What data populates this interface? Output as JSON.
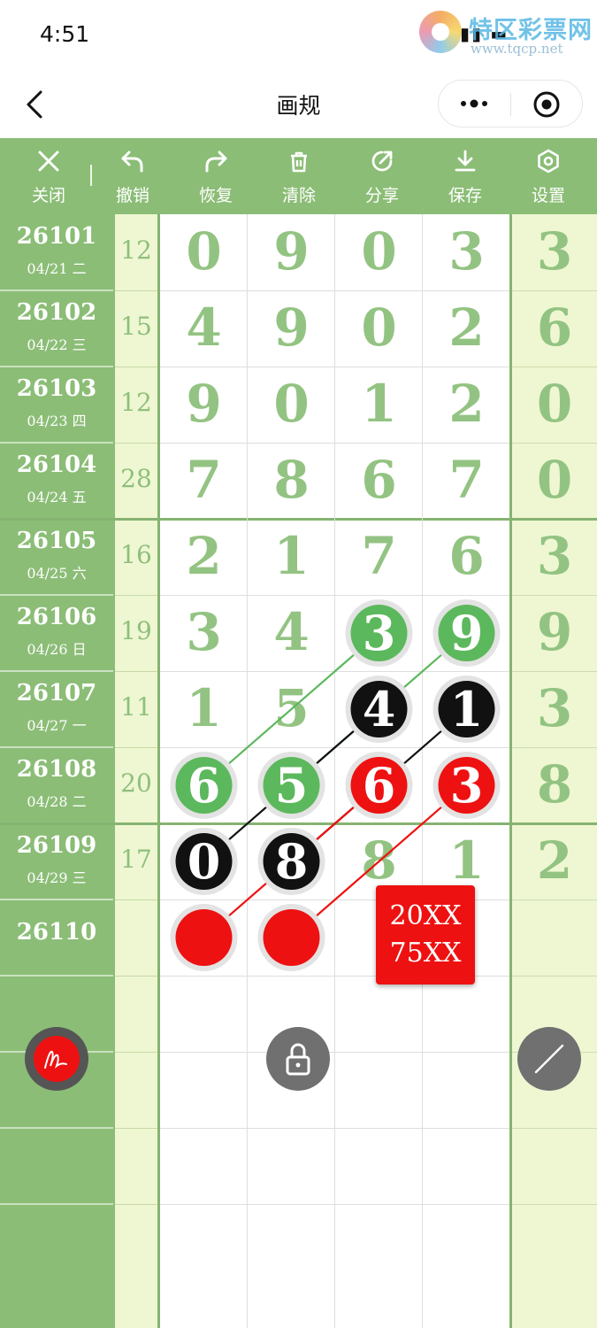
{
  "status_bar": {
    "time": "4:51",
    "watermark": "特区彩票网",
    "watermark_url": "www.tqcp.net"
  },
  "nav": {
    "title": "画规"
  },
  "toolbar": [
    {
      "key": "close",
      "label": "关闭",
      "icon": "close-icon"
    },
    {
      "key": "undo",
      "label": "撤销",
      "icon": "undo-icon"
    },
    {
      "key": "redo",
      "label": "恢复",
      "icon": "redo-icon"
    },
    {
      "key": "clear",
      "label": "清除",
      "icon": "trash-icon"
    },
    {
      "key": "share",
      "label": "分享",
      "icon": "share-icon"
    },
    {
      "key": "save",
      "label": "保存",
      "icon": "download-icon"
    },
    {
      "key": "settings",
      "label": "设置",
      "icon": "hexagon-gear-icon"
    }
  ],
  "rows": [
    {
      "issue": "26101",
      "date": "04/21 二",
      "sum": "12",
      "digits": [
        "0",
        "9",
        "0",
        "3"
      ],
      "tail": "3"
    },
    {
      "issue": "26102",
      "date": "04/22 三",
      "sum": "15",
      "digits": [
        "4",
        "9",
        "0",
        "2"
      ],
      "tail": "6"
    },
    {
      "issue": "26103",
      "date": "04/23 四",
      "sum": "12",
      "digits": [
        "9",
        "0",
        "1",
        "2"
      ],
      "tail": "0"
    },
    {
      "issue": "26104",
      "date": "04/24 五",
      "sum": "28",
      "digits": [
        "7",
        "8",
        "6",
        "7"
      ],
      "tail": "0"
    },
    {
      "issue": "26105",
      "date": "04/25 六",
      "sum": "16",
      "digits": [
        "2",
        "1",
        "7",
        "6"
      ],
      "tail": "3"
    },
    {
      "issue": "26106",
      "date": "04/26 日",
      "sum": "19",
      "digits": [
        "3",
        "4",
        "3",
        "9"
      ],
      "tail": "9"
    },
    {
      "issue": "26107",
      "date": "04/27 一",
      "sum": "11",
      "digits": [
        "1",
        "5",
        "4",
        "1"
      ],
      "tail": "3"
    },
    {
      "issue": "26108",
      "date": "04/28 二",
      "sum": "20",
      "digits": [
        "6",
        "5",
        "6",
        "3"
      ],
      "tail": "8"
    },
    {
      "issue": "26109",
      "date": "04/29 三",
      "sum": "17",
      "digits": [
        "0",
        "8",
        "8",
        "1"
      ],
      "tail": "2"
    },
    {
      "issue": "26110",
      "date": "",
      "sum": "",
      "digits": [
        "",
        "",
        "",
        ""
      ],
      "tail": ""
    }
  ],
  "markers": [
    {
      "row": 5,
      "col": 2,
      "color": "green",
      "value": "3"
    },
    {
      "row": 5,
      "col": 3,
      "color": "green",
      "value": "9"
    },
    {
      "row": 6,
      "col": 2,
      "color": "black",
      "value": "4"
    },
    {
      "row": 6,
      "col": 3,
      "color": "black",
      "value": "1"
    },
    {
      "row": 7,
      "col": 0,
      "color": "green",
      "value": "6"
    },
    {
      "row": 7,
      "col": 1,
      "color": "green",
      "value": "5"
    },
    {
      "row": 7,
      "col": 2,
      "color": "red",
      "value": "6"
    },
    {
      "row": 7,
      "col": 3,
      "color": "red",
      "value": "3"
    },
    {
      "row": 8,
      "col": 0,
      "color": "black",
      "value": "0"
    },
    {
      "row": 8,
      "col": 1,
      "color": "black",
      "value": "8"
    },
    {
      "row": 9,
      "col": 0,
      "color": "red",
      "value": ""
    },
    {
      "row": 9,
      "col": 1,
      "color": "red",
      "value": ""
    }
  ],
  "lines": [
    {
      "color": "green",
      "from": [
        7,
        0
      ],
      "to": [
        5,
        2
      ]
    },
    {
      "color": "green",
      "from": [
        7,
        1
      ],
      "to": [
        5,
        3
      ]
    },
    {
      "color": "black",
      "from": [
        8,
        0
      ],
      "to": [
        6,
        2
      ]
    },
    {
      "color": "black",
      "from": [
        8,
        1
      ],
      "to": [
        6,
        3
      ]
    },
    {
      "color": "red",
      "from": [
        9,
        0
      ],
      "to": [
        7,
        2
      ]
    },
    {
      "color": "red",
      "from": [
        9,
        1
      ],
      "to": [
        7,
        3
      ]
    }
  ],
  "note": {
    "line1": "20XX",
    "line2": "75XX"
  },
  "colors": {
    "green": "#5cb85c",
    "black": "#111111",
    "red": "#ee1111",
    "panel": "#8bbd76",
    "digit": "#93c382"
  },
  "floating_buttons": [
    {
      "key": "pen",
      "icon": "pen-scribble-icon"
    },
    {
      "key": "lock",
      "icon": "lock-icon"
    },
    {
      "key": "line",
      "icon": "line-tool-icon"
    }
  ]
}
